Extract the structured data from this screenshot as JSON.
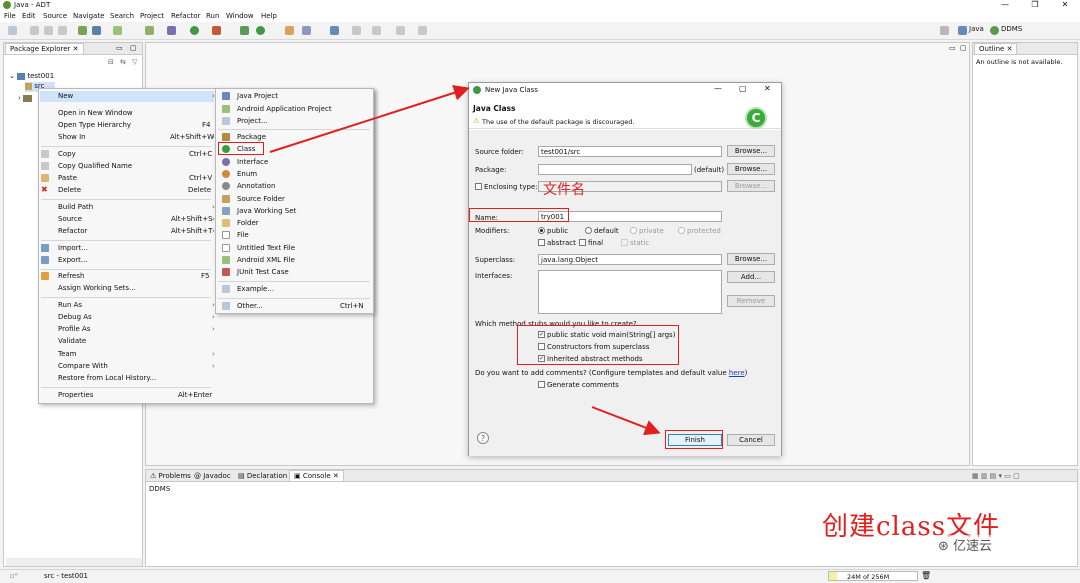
{
  "window": {
    "title": "Java - ADT",
    "controls": [
      "—",
      "❐",
      "✕"
    ]
  },
  "menubar": [
    "File",
    "Edit",
    "Source",
    "Navigate",
    "Search",
    "Project",
    "Refactor",
    "Run",
    "Window",
    "Help"
  ],
  "perspectives": {
    "java": "Java",
    "ddms": "DDMS"
  },
  "package_explorer": {
    "tab": "Package Explorer",
    "project": "test001",
    "src": "src"
  },
  "outline": {
    "tab": "Outline",
    "message": "An outline is not available."
  },
  "context_menu": {
    "items": [
      {
        "label": "New",
        "key": ""
      },
      {
        "label": "Open in New Window",
        "key": ""
      },
      {
        "label": "Open Type Hierarchy",
        "key": "F4"
      },
      {
        "label": "Show In",
        "key": "Alt+Shift+W"
      },
      {
        "label": "Copy",
        "key": "Ctrl+C"
      },
      {
        "label": "Copy Qualified Name",
        "key": ""
      },
      {
        "label": "Paste",
        "key": "Ctrl+V"
      },
      {
        "label": "Delete",
        "key": "Delete"
      },
      {
        "label": "Build Path",
        "key": ""
      },
      {
        "label": "Source",
        "key": "Alt+Shift+S"
      },
      {
        "label": "Refactor",
        "key": "Alt+Shift+T"
      },
      {
        "label": "Import...",
        "key": ""
      },
      {
        "label": "Export...",
        "key": ""
      },
      {
        "label": "Refresh",
        "key": "F5"
      },
      {
        "label": "Assign Working Sets...",
        "key": ""
      },
      {
        "label": "Run As",
        "key": ""
      },
      {
        "label": "Debug As",
        "key": ""
      },
      {
        "label": "Profile As",
        "key": ""
      },
      {
        "label": "Validate",
        "key": ""
      },
      {
        "label": "Team",
        "key": ""
      },
      {
        "label": "Compare With",
        "key": ""
      },
      {
        "label": "Restore from Local History...",
        "key": ""
      },
      {
        "label": "Properties",
        "key": "Alt+Enter"
      }
    ]
  },
  "submenu": {
    "items": [
      "Java Project",
      "Android Application Project",
      "Project...",
      "Package",
      "Class",
      "Interface",
      "Enum",
      "Annotation",
      "Source Folder",
      "Java Working Set",
      "Folder",
      "File",
      "Untitled Text File",
      "Android XML File",
      "JUnit Test Case",
      "Example...",
      "Other..."
    ],
    "other_key": "Ctrl+N"
  },
  "dialog": {
    "window_title": "New Java Class",
    "heading": "Java Class",
    "warning": "The use of the default package is discouraged.",
    "source_folder_label": "Source folder:",
    "source_folder_value": "test001/src",
    "package_label": "Package:",
    "package_default": "(default)",
    "enclosing_label": "Enclosing type:",
    "name_label": "Name:",
    "name_value": "try001",
    "modifiers_label": "Modifiers:",
    "mod_public": "public",
    "mod_default": "default",
    "mod_private": "private",
    "mod_protected": "protected",
    "mod_abstract": "abstract",
    "mod_final": "final",
    "mod_static": "static",
    "superclass_label": "Superclass:",
    "superclass_value": "java.lang.Object",
    "interfaces_label": "Interfaces:",
    "browse": "Browse...",
    "add": "Add...",
    "remove": "Remove",
    "stubs_question": "Which method stubs would you like to create?",
    "stub_main": "public static void main(String[] args)",
    "stub_ctor": "Constructors from superclass",
    "stub_inherited": "Inherited abstract methods",
    "comments_question": "Do you want to add comments? (Configure templates and default value",
    "comments_link": "here",
    "comments_end": ")",
    "generate_comments": "Generate comments",
    "finish": "Finish",
    "cancel": "Cancel",
    "help": "?"
  },
  "bottom": {
    "tabs": [
      "Problems",
      "Javadoc",
      "Declaration",
      "Console"
    ],
    "console_text": "DDMS"
  },
  "status": {
    "left": "src - test001",
    "memory": "24M of 256M"
  },
  "annotations": {
    "filename_label": "文件名",
    "watermark": "创建class文件",
    "brand": "亿速云"
  },
  "colors": {
    "red": "#e21f1f",
    "selection": "#cfe3fa",
    "link": "#1a3fbf"
  }
}
